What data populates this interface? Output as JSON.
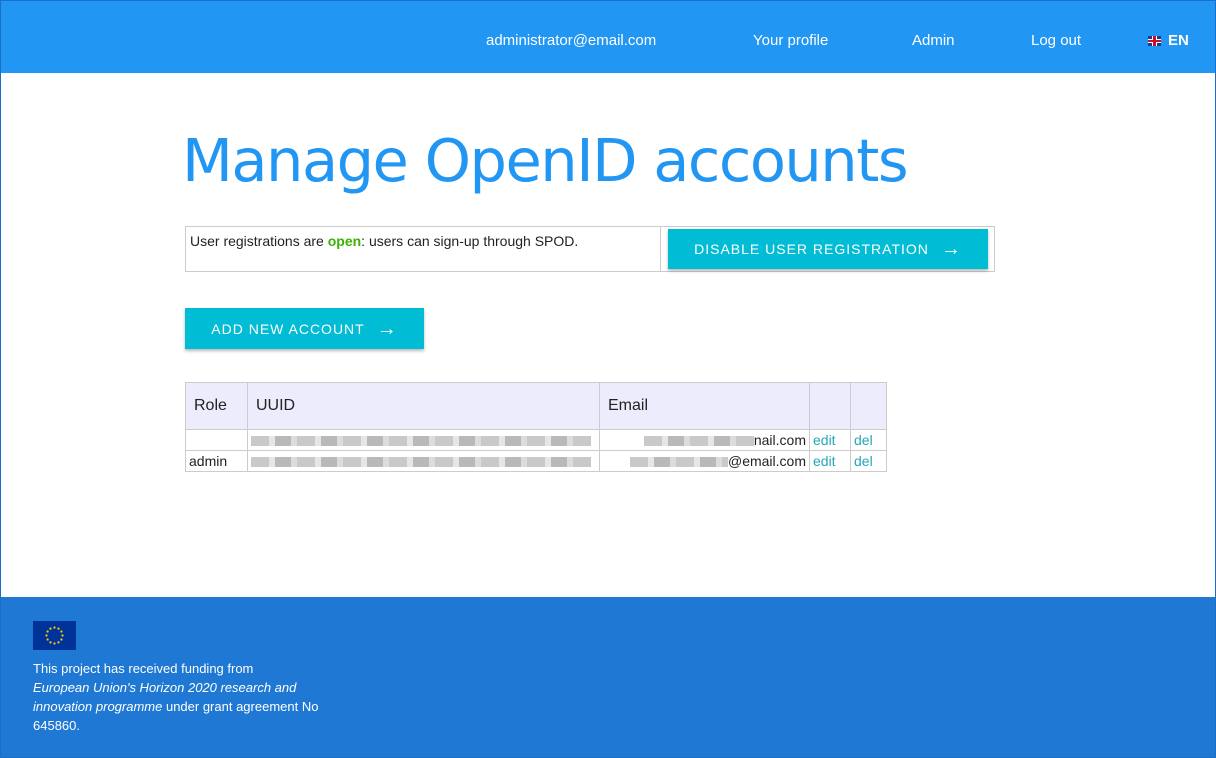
{
  "nav": {
    "email": "administrator@email.com",
    "profile": "Your profile",
    "admin": "Admin",
    "logout": "Log out",
    "language": "EN",
    "bar_color": "#2196f3"
  },
  "main": {
    "title": "Manage OpenID accounts",
    "registration": {
      "text_before": "User registrations are ",
      "status": "open",
      "text_after": ": users can sign-up through SPOD.",
      "disable_button": "DISABLE USER REGISTRATION",
      "status_color": "#3bb300"
    },
    "add_button": "ADD NEW ACCOUNT",
    "table": {
      "headers": {
        "role": "Role",
        "uuid": "UUID",
        "email": "Email"
      },
      "rows": [
        {
          "role": "",
          "uuid": "",
          "email_suffix": "nail.com",
          "edit": "edit",
          "del": "del"
        },
        {
          "role": "admin",
          "uuid": "",
          "email_suffix": "@email.com",
          "edit": "edit",
          "del": "del"
        }
      ]
    }
  },
  "footer": {
    "line1": "This project has received funding from",
    "programme": "European Union's Horizon 2020 research and innovation programme",
    "line3": " under grant agreement No 645860.",
    "color": "#1e78d4"
  },
  "icons": {
    "arrow": "arrow-right-icon",
    "flag": "uk-flag-icon",
    "eu": "eu-flag-icon"
  }
}
